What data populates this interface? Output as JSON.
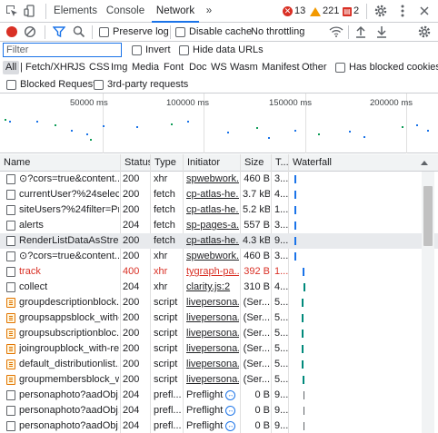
{
  "tabs": [
    {
      "label": "Elements"
    },
    {
      "label": "Console"
    },
    {
      "label": "Network"
    }
  ],
  "more_tabs": "»",
  "badges": {
    "errors": "13",
    "warnings": "221",
    "issues": "2"
  },
  "toolbar": {
    "preserve_log": "Preserve log",
    "disable_cache": "Disable cache",
    "throttling": "No throttling"
  },
  "filter": {
    "placeholder": "Filter",
    "invert": "Invert",
    "hide_data_urls": "Hide data URLs"
  },
  "types": [
    "All",
    "Fetch/XHR",
    "JS",
    "CSS",
    "Img",
    "Media",
    "Font",
    "Doc",
    "WS",
    "Wasm",
    "Manifest",
    "Other"
  ],
  "has_blocked_cookies": "Has blocked cookies",
  "blocked_requests": "Blocked Requests",
  "third_party": "3rd-party requests",
  "overview_ticks": [
    "50000 ms",
    "100000 ms",
    "150000 ms",
    "200000 ms"
  ],
  "columns": {
    "name": "Name",
    "status": "Status",
    "type": "Type",
    "initiator": "Initiator",
    "size": "Size",
    "time": "T...",
    "waterfall": "Waterfall"
  },
  "rows": [
    {
      "name": "⊙?cors=true&content...",
      "status": "200",
      "type": "xhr",
      "initiator": "spwebwork...",
      "size": "460 B",
      "time": "3...",
      "kind": "plain"
    },
    {
      "name": "currentUser?%24select...",
      "status": "200",
      "type": "fetch",
      "initiator": "cp-atlas-he...",
      "size": "3.7 kB",
      "time": "4...",
      "kind": "plain"
    },
    {
      "name": "siteUsers?%24filter=Pri...",
      "status": "200",
      "type": "fetch",
      "initiator": "cp-atlas-he...",
      "size": "5.2 kB",
      "time": "1...",
      "kind": "plain"
    },
    {
      "name": "alerts",
      "status": "204",
      "type": "fetch",
      "initiator": "sp-pages-a...",
      "size": "557 B",
      "time": "3...",
      "kind": "plain"
    },
    {
      "name": "RenderListDataAsStream",
      "status": "200",
      "type": "fetch",
      "initiator": "cp-atlas-he...",
      "size": "4.3 kB",
      "time": "9...",
      "kind": "plain",
      "selected": true
    },
    {
      "name": "⊙?cors=true&content...",
      "status": "200",
      "type": "xhr",
      "initiator": "spwebwork...",
      "size": "460 B",
      "time": "3...",
      "kind": "plain"
    },
    {
      "name": "track",
      "status": "400",
      "type": "xhr",
      "initiator": "tygraph-pa...",
      "size": "392 B",
      "time": "1...",
      "kind": "plain",
      "error": true
    },
    {
      "name": "collect",
      "status": "204",
      "type": "xhr",
      "initiator": "clarity.js:2",
      "size": "310 B",
      "time": "4...",
      "kind": "plain"
    },
    {
      "name": "groupdescriptionblock...",
      "status": "200",
      "type": "script",
      "initiator": "livepersona...",
      "size": "(Ser...",
      "time": "5...",
      "kind": "doc"
    },
    {
      "name": "groupsappsblock_with-...",
      "status": "200",
      "type": "script",
      "initiator": "livepersona...",
      "size": "(Ser...",
      "time": "5...",
      "kind": "doc"
    },
    {
      "name": "groupsubscriptionbloc...",
      "status": "200",
      "type": "script",
      "initiator": "livepersona...",
      "size": "(Ser...",
      "time": "5...",
      "kind": "doc"
    },
    {
      "name": "joingroupblock_with-re...",
      "status": "200",
      "type": "script",
      "initiator": "livepersona...",
      "size": "(Ser...",
      "time": "5...",
      "kind": "doc"
    },
    {
      "name": "default_distributionlist...",
      "status": "200",
      "type": "script",
      "initiator": "livepersona...",
      "size": "(Ser...",
      "time": "5...",
      "kind": "doc"
    },
    {
      "name": "groupmembersblock_w...",
      "status": "200",
      "type": "script",
      "initiator": "livepersona...",
      "size": "(Ser...",
      "time": "5...",
      "kind": "doc"
    },
    {
      "name": "personaphoto?aadObj...",
      "status": "204",
      "type": "prefl...",
      "initiator": "Preflight",
      "size": "0 B",
      "time": "9...",
      "kind": "plain",
      "preflight": true
    },
    {
      "name": "personaphoto?aadObj...",
      "status": "204",
      "type": "prefl...",
      "initiator": "Preflight",
      "size": "0 B",
      "time": "9...",
      "kind": "plain",
      "preflight": true
    },
    {
      "name": "personaphoto?aadObj...",
      "status": "204",
      "type": "prefl...",
      "initiator": "Preflight",
      "size": "0 B",
      "time": "9...",
      "kind": "plain",
      "preflight": true
    }
  ],
  "colors": {
    "accent": "#1a73e8",
    "error": "#d93025",
    "record": "#d93025",
    "warning": "#f29900"
  }
}
